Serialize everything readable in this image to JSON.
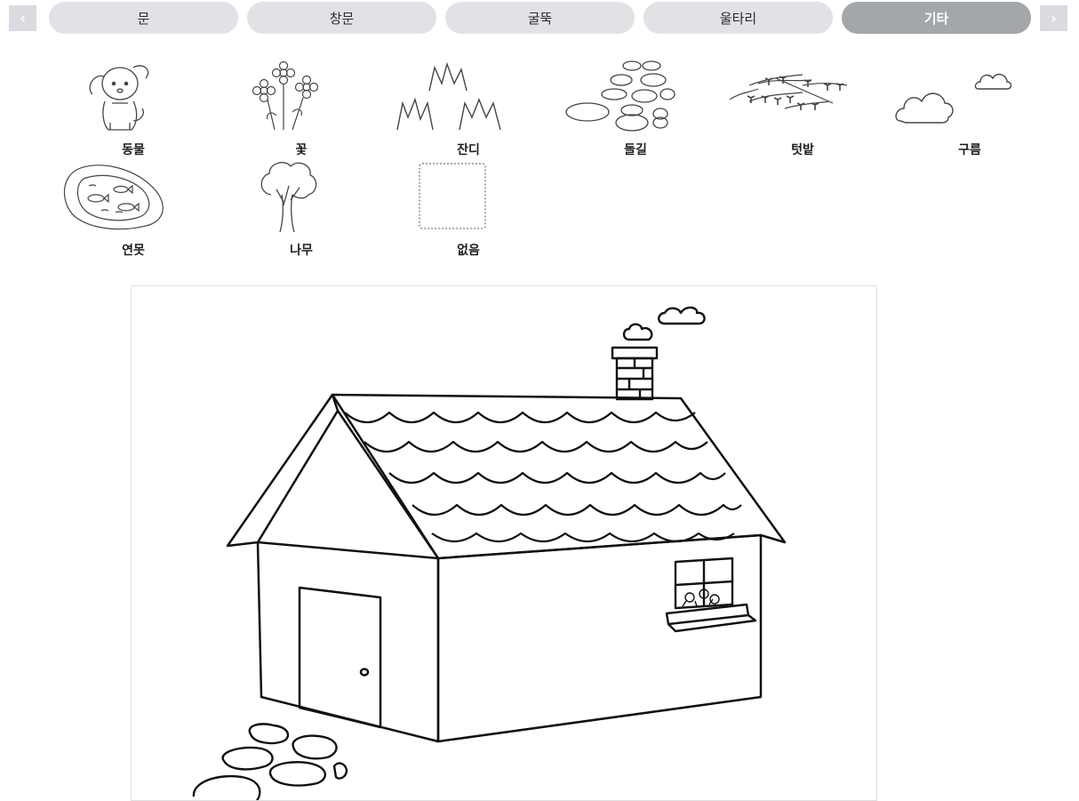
{
  "navigation": {
    "prev_icon": "‹",
    "next_icon": "›"
  },
  "tabs": [
    {
      "label": "문"
    },
    {
      "label": "창문"
    },
    {
      "label": "굴뚝"
    },
    {
      "label": "울타리"
    },
    {
      "label": "기타",
      "active": true
    }
  ],
  "palette": {
    "items": [
      {
        "label": "동물",
        "icon": "dog-icon"
      },
      {
        "label": "꽃",
        "icon": "flower-icon"
      },
      {
        "label": "잔디",
        "icon": "grass-icon"
      },
      {
        "label": "돌길",
        "icon": "stone-path-icon"
      },
      {
        "label": "텃밭",
        "icon": "garden-icon"
      },
      {
        "label": "구름",
        "icon": "cloud-icon"
      },
      {
        "label": "연못",
        "icon": "pond-icon"
      },
      {
        "label": "나무",
        "icon": "tree-icon"
      },
      {
        "label": "없음",
        "icon": "empty-icon"
      }
    ]
  },
  "colors": {
    "tab_active": "#a3a6ab",
    "tab_inactive": "#e1e2e6",
    "arrow": "#d9dbe1"
  }
}
